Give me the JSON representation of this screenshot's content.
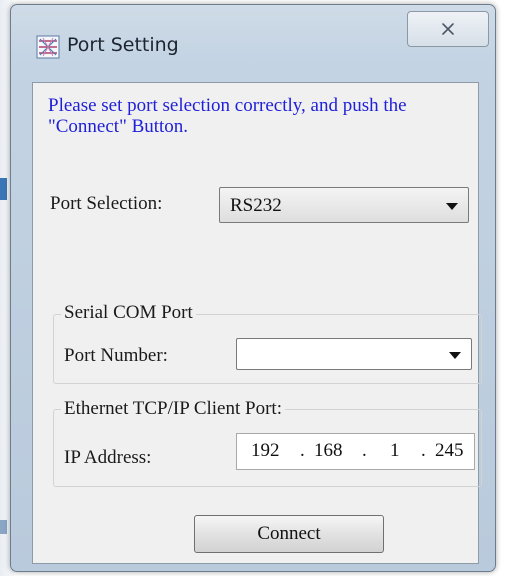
{
  "window": {
    "title": "Port Setting",
    "icons": {
      "app": "port-setting-app-icon",
      "close": "close-icon"
    }
  },
  "instructions": "Please set port selection correctly, and push the \"Connect\" Button.",
  "port_selection": {
    "label": "Port Selection:",
    "selected": "RS232",
    "arrow_icon": "chevron-down-icon"
  },
  "serial": {
    "group_label": "Serial COM Port",
    "port_number_label": "Port Number:",
    "port_number_value": ""
  },
  "ethernet": {
    "group_label": "Ethernet TCP/IP Client Port:",
    "ip_label": "IP Address:",
    "ip_octets": [
      "192",
      "168",
      "1",
      "245"
    ]
  },
  "connect_button": {
    "label": "Connect"
  },
  "colors": {
    "instruction_text": "#2020d8",
    "frame": "#c3d3e3",
    "client": "#f0f0f0"
  }
}
